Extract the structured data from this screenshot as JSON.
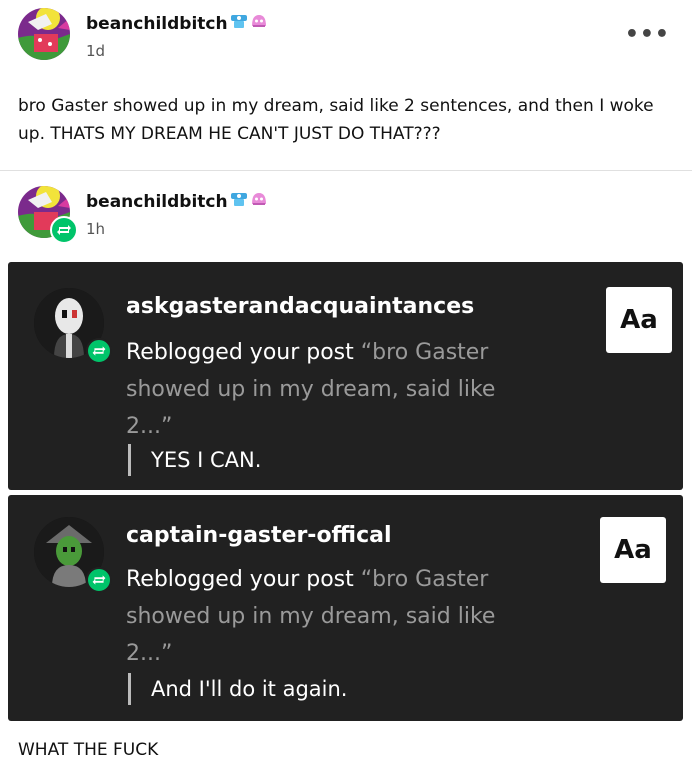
{
  "posts": [
    {
      "username": "beanchildbitch",
      "timestamp": "1d",
      "body": "bro Gaster showed up in my dream, said like 2 sentences, and then I woke up. THATS MY DREAM HE CAN'T JUST DO THAT???",
      "more_label": "•••"
    },
    {
      "username": "beanchildbitch",
      "timestamp": "1h"
    }
  ],
  "notifications": [
    {
      "username": "askgasterandacquaintances",
      "action": "Reblogged your post",
      "quote": "“bro Gaster showed up in my dream, said like 2...”",
      "reply": "YES I CAN.",
      "aa_label": "Aa"
    },
    {
      "username": "captain-gaster-offical",
      "action": "Reblogged your post",
      "quote": "“bro Gaster showed up in my dream, said like 2...”",
      "reply": "And I'll do it again.",
      "aa_label": "Aa"
    }
  ],
  "footer": "WHAT THE FUCK",
  "icons": {
    "reblog": "reblog-icon",
    "more": "more-options-icon",
    "badge_blue": "blue-badge-icon",
    "badge_pink": "pink-badge-icon"
  },
  "colors": {
    "reblog_green": "#00c46a",
    "card_bg": "#212121",
    "muted_text": "#9a9a9a"
  }
}
